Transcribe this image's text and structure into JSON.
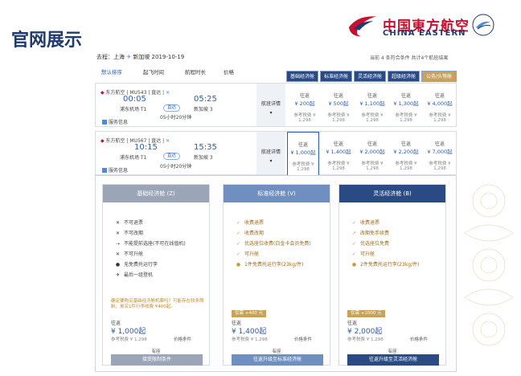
{
  "slide": {
    "title": "官网展示",
    "logo_cn": "中国東方航空",
    "logo_en": "CHINA EASTERN"
  },
  "search": {
    "route_prefix": "去程：上海",
    "route_suffix": "新加坡 2019-10-19",
    "result_count": "当前 4 条符合条件 共计4个航班结果"
  },
  "sort": [
    "默认排序",
    "起飞时间",
    "航程时长",
    "价格"
  ],
  "cabin_tabs": [
    "基础经济舱",
    "标准经济舱",
    "灵活经济舱",
    "超级经济舱",
    "公务/头等舱"
  ],
  "flights": [
    {
      "airline": "东方航空 | MU543 | 直达 |",
      "dep_time": "00:05",
      "arr_time": "05:25",
      "dep_airport": "浦东机场 T1",
      "arr_airport": "新加坡 3",
      "direct": "直达",
      "duration": "05小时20分钟",
      "service": "服务信息",
      "detail": "航班详情",
      "prices": [
        {
          "dep": "往返",
          "amount": "¥ 200起",
          "ref": "参考税费 ¥ 1,298"
        },
        {
          "dep": "往返",
          "amount": "¥ 500起",
          "ref": "参考税费 ¥ 1,298"
        },
        {
          "dep": "往返",
          "amount": "¥ 1,100起",
          "ref": "参考税费 ¥ 1,298"
        },
        {
          "dep": "往返",
          "amount": "¥ 1,300起",
          "ref": "参考税费 ¥ 1,298"
        },
        {
          "dep": "往返",
          "amount": "¥ 4,000起",
          "ref": "参考税费 ¥ 1,298"
        }
      ]
    },
    {
      "airline": "东方航空 | MU567 | 直达 |",
      "dep_time": "10:15",
      "arr_time": "15:35",
      "dep_airport": "浦东机场 T1",
      "arr_airport": "新加坡 3",
      "direct": "直达",
      "duration": "05小时20分钟",
      "service": "服务信息",
      "detail": "航班详情",
      "prices": [
        {
          "dep": "往返",
          "amount": "¥ 1,000起",
          "ref": "参考税费 ¥ 1,298"
        },
        {
          "dep": "往返",
          "amount": "¥ 1,400起",
          "ref": "参考税费 ¥ 1,298"
        },
        {
          "dep": "往返",
          "amount": "¥ 2,000起",
          "ref": "参考税费 ¥ 1,298"
        },
        {
          "dep": "往返",
          "amount": "¥ 2,200起",
          "ref": "参考税费 ¥ 1,298"
        },
        {
          "dep": "往返",
          "amount": "¥ 7,000起",
          "ref": "参考税费 ¥ 1,298"
        }
      ]
    }
  ],
  "cards": [
    {
      "title": "基础经济舱 (Z)",
      "color": "#9aa6b8",
      "features": [
        {
          "icon": "✕",
          "text": "不可退票",
          "ok": false
        },
        {
          "icon": "✕",
          "text": "不可改期",
          "ok": false
        },
        {
          "icon": "⇢",
          "text": "不能提前选座(不可在线值机)",
          "ok": false
        },
        {
          "icon": "✕",
          "text": "不可升舱",
          "ok": false
        },
        {
          "icon": "●",
          "text": "无免费托运行李",
          "ok": false
        },
        {
          "icon": "✈",
          "text": "最后一组登机",
          "ok": false
        }
      ],
      "note": "确定要购买基础经济舱机票吗？可能存在较多限制，单买1件行李收费 ¥400起。",
      "upgrade": "",
      "dep": "往返",
      "amount": "¥ 1,000起",
      "ref": "参考税费 ¥ 1,298",
      "cond": "价格条件",
      "remain": "有座",
      "button": "接受限制条件",
      "button_color": "#9aa6b8"
    },
    {
      "title": "标准经济舱 (V)",
      "color": "#6f8fc0",
      "features": [
        {
          "icon": "✓",
          "text": "收费退票",
          "ok": true
        },
        {
          "icon": "✓",
          "text": "收费改期",
          "ok": true
        },
        {
          "icon": "✓",
          "text": "优选座位收费(白金卡会员免费)",
          "ok": true
        },
        {
          "icon": "✓",
          "text": "可升舱",
          "ok": true
        },
        {
          "icon": "●",
          "text": "1件免费托运行李(23kg/件)",
          "ok": true
        }
      ],
      "note": "",
      "upgrade": "仅需 +400 元",
      "dep": "往返",
      "amount": "¥ 1,400起",
      "ref": "参考税费 ¥ 1,298",
      "cond": "价格条件",
      "remain": "有座",
      "button": "往返升级至标准经济舱",
      "button_color": "#6f8fc0"
    },
    {
      "title": "灵活经济舱 (B)",
      "color": "#2a4a84",
      "features": [
        {
          "icon": "✓",
          "text": "收费退票",
          "ok": true
        },
        {
          "icon": "↗",
          "text": "改期免手续费",
          "ok": true
        },
        {
          "icon": "✓",
          "text": "优选座位免费",
          "ok": true
        },
        {
          "icon": "✓",
          "text": "可升舱",
          "ok": true
        },
        {
          "icon": "●",
          "text": "2件免费托运行李(23kg/件)",
          "ok": true
        }
      ],
      "note": "",
      "upgrade": "仅需 +1000 元",
      "dep": "往返",
      "amount": "¥ 2,000起",
      "ref": "参考税费 ¥ 1,298",
      "cond": "价格条件",
      "remain": "有座",
      "button": "往返升级至灵活经济舱",
      "button_color": "#2a4a84"
    }
  ]
}
